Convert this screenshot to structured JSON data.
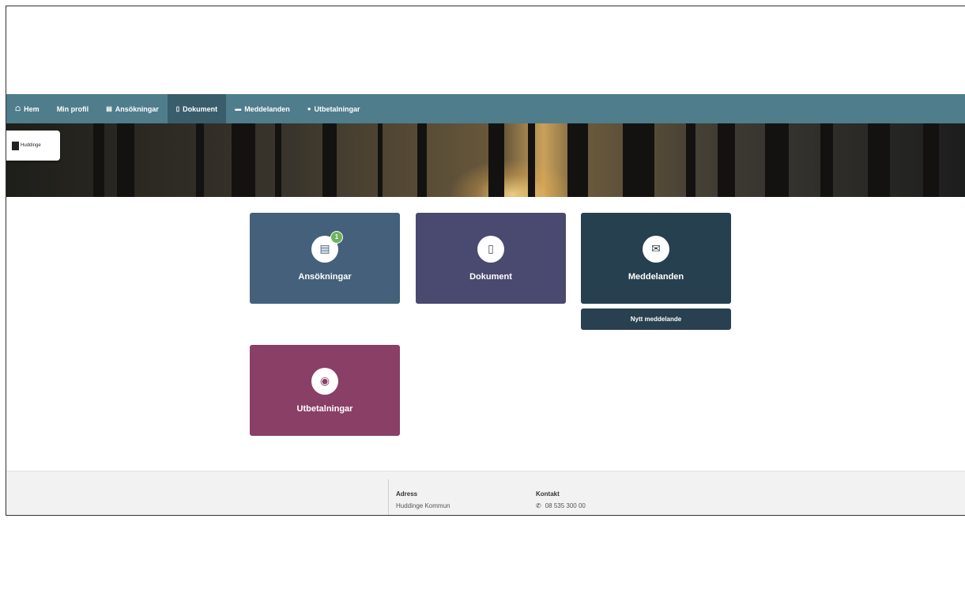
{
  "nav": {
    "items": [
      {
        "icon": "home-icon",
        "glyph": "🏠",
        "label": "Hem"
      },
      {
        "icon": "",
        "glyph": "",
        "label": "Min profil"
      },
      {
        "icon": "doc-stack-icon",
        "glyph": "▤",
        "label": "Ansökningar"
      },
      {
        "icon": "document-icon",
        "glyph": "▯",
        "label": "Dokument"
      },
      {
        "icon": "message-icon",
        "glyph": "▬",
        "label": "Meddelanden"
      },
      {
        "icon": "coin-icon",
        "glyph": "●",
        "label": "Utbetalningar"
      }
    ],
    "active_index": 3,
    "bg_color": "#4f7d8c",
    "active_color": "#3a5d6b"
  },
  "logo": {
    "text": "Huddinge"
  },
  "tiles": [
    {
      "label": "Ansökningar",
      "icon": "applications-icon",
      "glyph": "▤",
      "color": "#44607b",
      "badge": "1"
    },
    {
      "label": "Dokument",
      "icon": "document-icon",
      "glyph": "▯",
      "color": "#4a4a70"
    },
    {
      "label": "Meddelanden",
      "icon": "envelope-icon",
      "glyph": "✉",
      "color": "#27404f"
    },
    {
      "label": "Utbetalningar",
      "icon": "money-icon",
      "glyph": "⚫",
      "color": "#8a3f66"
    }
  ],
  "new_message_button": {
    "label": "Nytt meddelande"
  },
  "footer": {
    "address_heading": "Adress",
    "address_value": "Huddinge Kommun",
    "contact_heading": "Kontakt",
    "phone": "08 535 300 00"
  }
}
